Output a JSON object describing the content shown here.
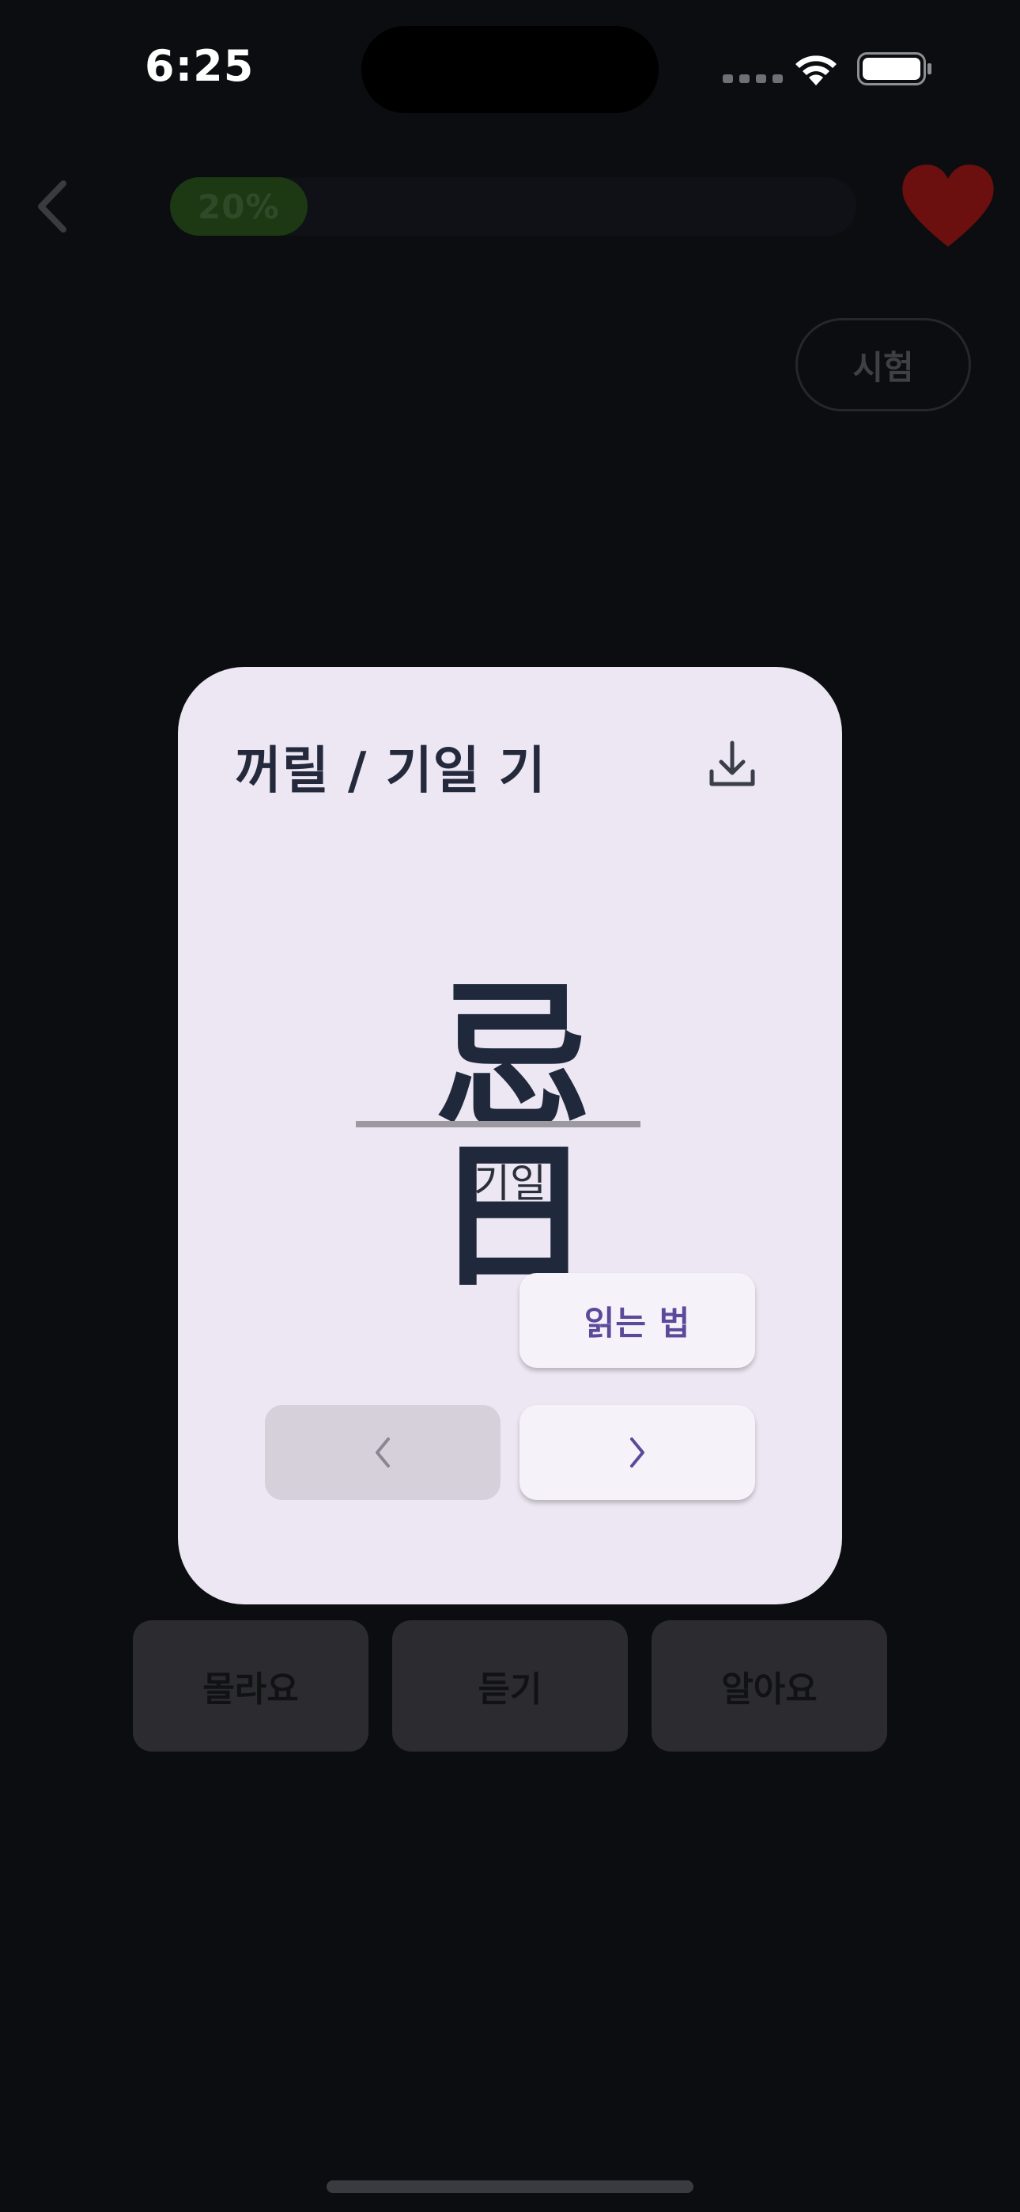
{
  "status_bar": {
    "time": "6:25"
  },
  "header": {
    "progress_label": "20%",
    "progress_fraction": 0.2,
    "test_button_label": "시험"
  },
  "card": {
    "title": "꺼릴 / 기일 기",
    "hanja": "忌日",
    "reading": "기일",
    "how_to_read_label": "읽는 법"
  },
  "answers": {
    "dont_know_label": "몰라요",
    "listen_label": "듣기",
    "know_label": "알아요"
  },
  "icons": {
    "back": "chevron-left-icon",
    "favorite": "heart-icon",
    "download": "download-icon",
    "prev": "chevron-left-icon",
    "next": "chevron-right-icon"
  },
  "colors": {
    "progress_fill": "#1c3914",
    "heart": "#6b0f0f",
    "card_background": "#ece7f2",
    "accent": "#5b4a99"
  }
}
